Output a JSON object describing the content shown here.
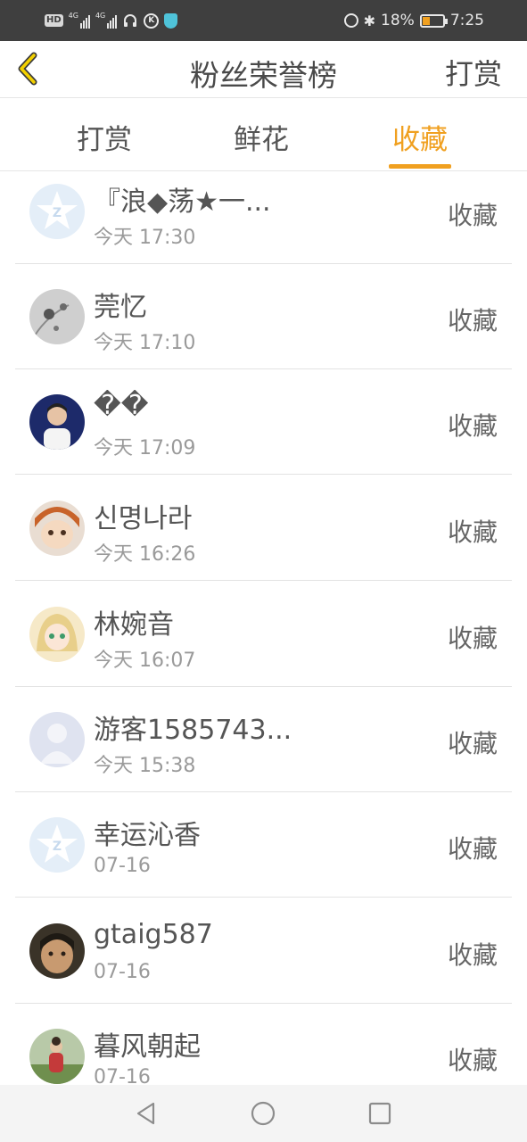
{
  "status_bar": {
    "hd_badge": "HD",
    "net1": "4G",
    "net2": "4G",
    "k_icon": "K",
    "battery_percent": "18%",
    "time": "7:25",
    "battery_level": 0.18
  },
  "header": {
    "back_icon": "chevron-left-icon",
    "title": "粉丝荣誉榜",
    "action": "打赏"
  },
  "tabs": [
    {
      "label": "打赏",
      "active": false
    },
    {
      "label": "鲜花",
      "active": false
    },
    {
      "label": "收藏",
      "active": true
    }
  ],
  "accent_color": "#f0a020",
  "list": [
    {
      "name": "『浪◆荡★一...",
      "time": "今天 17:30",
      "action": "收藏",
      "avatar": "default-qzone-avatar"
    },
    {
      "name": "莞忆",
      "time": "今天 17:10",
      "action": "收藏",
      "avatar": "flower-photo-avatar"
    },
    {
      "name": "��",
      "time": "今天 17:09",
      "action": "收藏",
      "avatar": "person-photo-avatar"
    },
    {
      "name": "신명나라",
      "time": "今天 16:26",
      "action": "收藏",
      "avatar": "anime-avatar"
    },
    {
      "name": "林婉音",
      "time": "今天 16:07",
      "action": "收藏",
      "avatar": "anime-girl-avatar"
    },
    {
      "name": "游客1585743...",
      "time": "今天 15:38",
      "action": "收藏",
      "avatar": "default-person-avatar"
    },
    {
      "name": "幸运沁香",
      "time": "07-16",
      "action": "收藏",
      "avatar": "default-qzone-avatar"
    },
    {
      "name": "gtaig587",
      "time": "07-16",
      "action": "收藏",
      "avatar": "face-photo-avatar"
    },
    {
      "name": "暮风朝起",
      "time": "07-16",
      "action": "收藏",
      "avatar": "outdoor-photo-avatar"
    }
  ],
  "nav_bar": {
    "back_icon": "triangle-back-icon",
    "home_icon": "circle-home-icon",
    "recent_icon": "square-recent-icon"
  }
}
